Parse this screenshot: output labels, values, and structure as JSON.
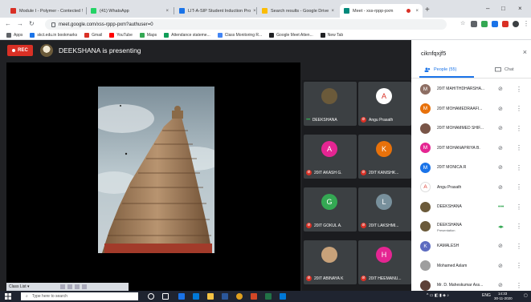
{
  "browser": {
    "tabs": [
      {
        "title": "Module I - Polymer - Contected !",
        "favicon_color": "#d93025"
      },
      {
        "title": "(41) WhatsApp",
        "favicon_color": "#25d366"
      },
      {
        "title": "LIT-A-SIP Student Induction Pro",
        "favicon_color": "#1a73e8"
      },
      {
        "title": "Search results - Google Drive",
        "favicon_color": "#fbbc04"
      },
      {
        "title": "Meet - xss-rppp-pxm",
        "favicon_color": "#00897b"
      }
    ],
    "new_tab_icon": "+",
    "url": "meet.google.com/xss-rppp-pxm?authuser=0",
    "bookmarks": [
      {
        "label": "Apps",
        "color": "#5f6368"
      },
      {
        "label": "skct.edu.in bookmarks",
        "color": "#1a73e8"
      },
      {
        "label": "Gmail",
        "color": "#d93025"
      },
      {
        "label": "YouTube",
        "color": "#ff0000"
      },
      {
        "label": "Maps",
        "color": "#34a853"
      },
      {
        "label": "Attendance stateme...",
        "color": "#0f9d58"
      },
      {
        "label": "Class Monitoring R...",
        "color": "#4285f4"
      },
      {
        "label": "Google Meet Atten...",
        "color": "#202124"
      },
      {
        "label": "New Tab",
        "color": "#202124"
      }
    ]
  },
  "meet": {
    "rec_label": "REC",
    "presenting_text": "DEEKSHANA is presenting",
    "tiles": [
      {
        "name": "DEEKSHANA",
        "initial": "",
        "color": "#6b5a3a",
        "muted": false,
        "speaking": true
      },
      {
        "name": "Angu Prasath",
        "initial": "A",
        "color": "#ffffff",
        "muted": true,
        "speaking": false
      },
      {
        "name": "20IT AKASH G.",
        "initial": "A",
        "color": "#e52592",
        "muted": true,
        "speaking": false
      },
      {
        "name": "20IT KANISHK...",
        "initial": "K",
        "color": "#e8710a",
        "muted": true,
        "speaking": false
      },
      {
        "name": "20IT GOKUL A.",
        "initial": "G",
        "color": "#34a853",
        "muted": true,
        "speaking": false
      },
      {
        "name": "20IT LAKSHMI...",
        "initial": "L",
        "color": "#78909c",
        "muted": true,
        "speaking": false
      },
      {
        "name": "20IT ABINAYA K",
        "initial": "",
        "color": "#c8a27a",
        "muted": true,
        "speaking": false
      },
      {
        "name": "20IT HEEMANU...",
        "initial": "H",
        "color": "#e52592",
        "muted": true,
        "speaking": false
      }
    ],
    "class_list_label": "Class List ▾"
  },
  "panel": {
    "title": "ciknfqxjf5",
    "people_tab": "People (55)",
    "chat_tab": "Chat",
    "participants": [
      {
        "name": "20IT MAHITHDHARSHA...",
        "initial": "M",
        "color": "#8d6e63",
        "sub": "",
        "speaking": false
      },
      {
        "name": "20IT MOHAMEDRAAFI...",
        "initial": "M",
        "color": "#e8710a",
        "sub": "",
        "speaking": false
      },
      {
        "name": "20IT MOHAMMED SHIF...",
        "initial": "",
        "color": "#795548",
        "sub": "",
        "speaking": false
      },
      {
        "name": "20IT MOHANAPRIYA B.",
        "initial": "M",
        "color": "#e52592",
        "sub": "",
        "speaking": false
      },
      {
        "name": "20IT MONICA.R",
        "initial": "M",
        "color": "#1a73e8",
        "sub": "",
        "speaking": false
      },
      {
        "name": "Angu Prasath",
        "initial": "A",
        "color": "#ffffff",
        "sub": "",
        "speaking": false
      },
      {
        "name": "DEEKSHANA",
        "initial": "",
        "color": "#6b5a3a",
        "sub": "",
        "speaking": true
      },
      {
        "name": "DEEKSHANA",
        "initial": "",
        "color": "#6b5a3a",
        "sub": "Presentation",
        "speaking": true
      },
      {
        "name": "KAMALESH",
        "initial": "K",
        "color": "#5c6bc0",
        "sub": "",
        "speaking": false
      },
      {
        "name": "Mohamed Aslam",
        "initial": "",
        "color": "#9e9e9e",
        "sub": "",
        "speaking": false
      },
      {
        "name": "Mr. D. Maheskumar Ass...",
        "initial": "",
        "color": "#5d4037",
        "sub": "",
        "speaking": false
      }
    ]
  },
  "taskbar": {
    "search_placeholder": "Type here to search",
    "lang": "ENG",
    "time": "14:33",
    "date": "30-11-2020"
  }
}
